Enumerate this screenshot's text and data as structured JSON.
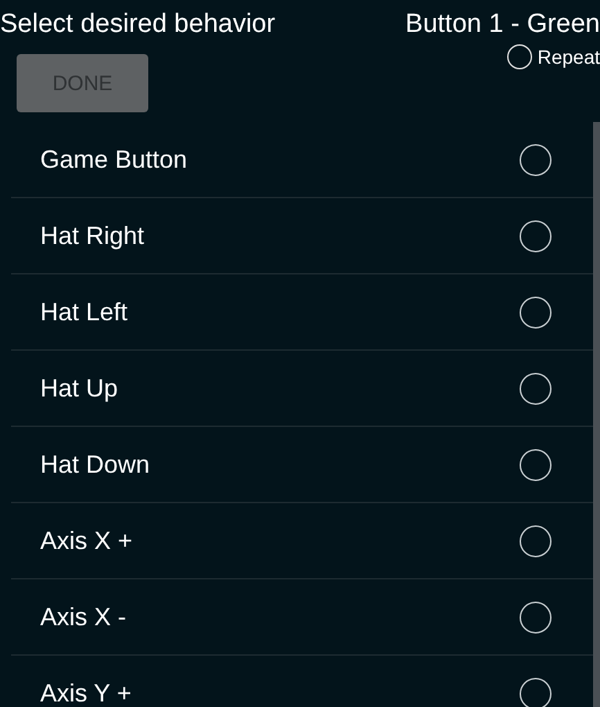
{
  "header": {
    "title": "Select desired behavior",
    "button_name": "Button 1 - Green"
  },
  "repeat": {
    "label": "Repeat",
    "checked": false
  },
  "done_button": {
    "label": "DONE",
    "disabled": true
  },
  "behaviors": [
    {
      "label": "Game Button",
      "selected": false
    },
    {
      "label": "Hat Right",
      "selected": false
    },
    {
      "label": "Hat Left",
      "selected": false
    },
    {
      "label": "Hat Up",
      "selected": false
    },
    {
      "label": "Hat Down",
      "selected": false
    },
    {
      "label": "Axis X +",
      "selected": false
    },
    {
      "label": "Axis X -",
      "selected": false
    },
    {
      "label": "Axis Y +",
      "selected": false
    }
  ]
}
